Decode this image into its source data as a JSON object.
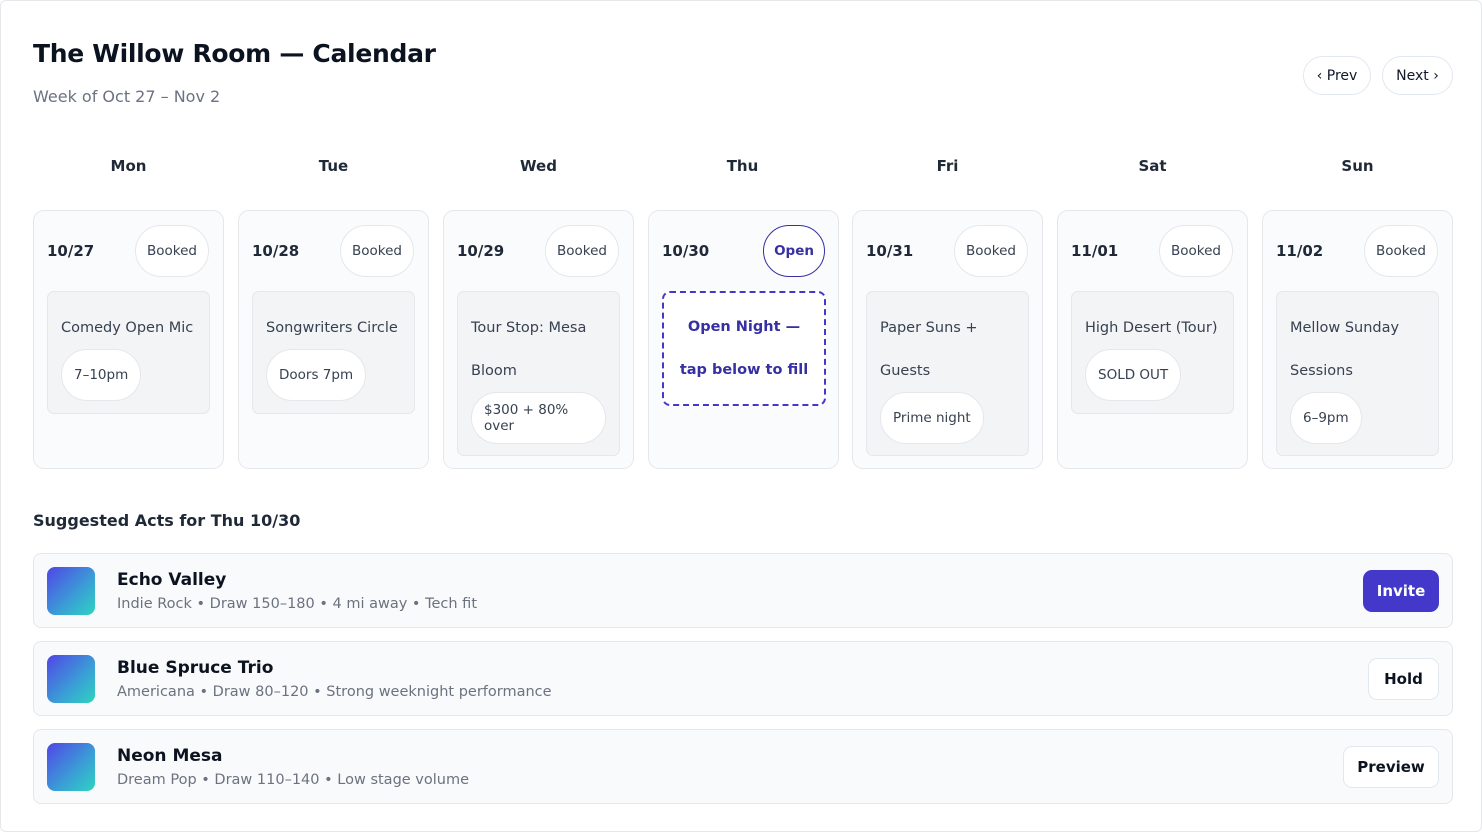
{
  "header": {
    "title": "The Willow Room — Calendar",
    "subtitle": "Week of Oct 27 – Nov 2",
    "prev_label": "‹ Prev",
    "next_label": "Next ›"
  },
  "days_of_week": [
    "Mon",
    "Tue",
    "Wed",
    "Thu",
    "Fri",
    "Sat",
    "Sun"
  ],
  "days": [
    {
      "date": "10/27",
      "status": "Booked",
      "event_lines": [
        "Comedy Open Mic"
      ],
      "tag": "7–10pm"
    },
    {
      "date": "10/28",
      "status": "Booked",
      "event_lines": [
        "Songwriters Circle"
      ],
      "tag": "Doors 7pm"
    },
    {
      "date": "10/29",
      "status": "Booked",
      "event_lines": [
        "Tour Stop: Mesa",
        "Bloom"
      ],
      "tag": "$300 + 80% over"
    },
    {
      "date": "10/30",
      "status": "Open",
      "open_lines": [
        "Open Night —",
        "tap below to fill"
      ]
    },
    {
      "date": "10/31",
      "status": "Booked",
      "event_lines": [
        "Paper Suns +",
        "Guests"
      ],
      "tag": "Prime night"
    },
    {
      "date": "11/01",
      "status": "Booked",
      "event_lines": [
        "High Desert (Tour)"
      ],
      "tag": "SOLD OUT"
    },
    {
      "date": "11/02",
      "status": "Booked",
      "event_lines": [
        "Mellow Sunday",
        "Sessions"
      ],
      "tag": "6–9pm"
    }
  ],
  "suggestions": {
    "title": "Suggested Acts for Thu 10/30",
    "acts": [
      {
        "name": "Echo Valley",
        "meta": "Indie Rock • Draw 150–180 • 4 mi away • Tech fit",
        "action": "Invite"
      },
      {
        "name": "Blue Spruce Trio",
        "meta": "Americana • Draw 80–120 • Strong weeknight performance",
        "action": "Hold"
      },
      {
        "name": "Neon Mesa",
        "meta": "Dream Pop • Draw 110–140 • Low stage volume",
        "action": "Preview"
      }
    ]
  },
  "colors": {
    "accent": "#4338ca",
    "card_bg": "#fafbfc",
    "event_bg": "#f3f4f6"
  }
}
